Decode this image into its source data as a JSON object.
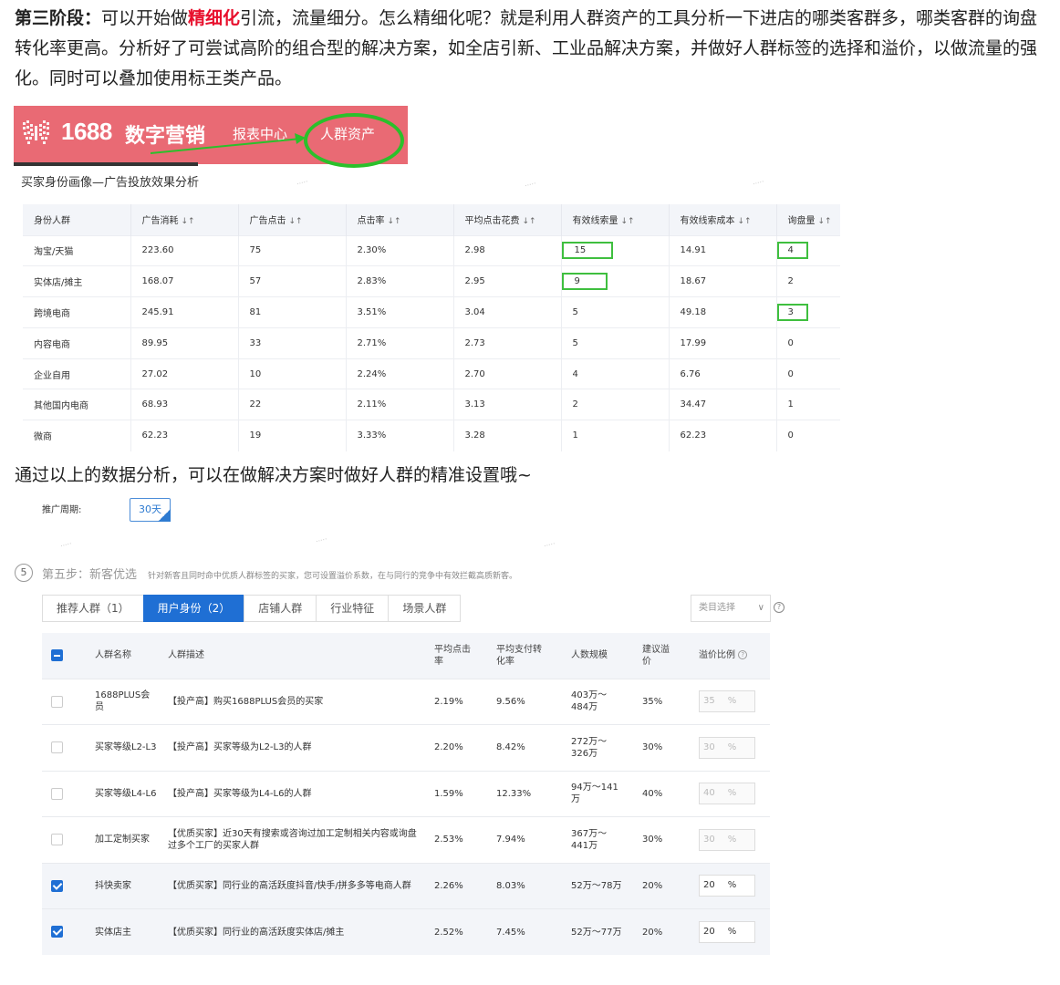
{
  "intro": {
    "lead_bold": "第三阶段：",
    "text_before": "可以开始做",
    "highlight": "精细化",
    "text_after": "引流，流量细分。怎么精细化呢？就是利用人群资产的工具分析一下进店的哪类客群多，哪类客群的询盘转化率更高。分析好了可尝试高阶的组合型的解决方案，如全店引新、工业品解决方案，并做好人群标签的选择和溢价，以做流量的强化。同时可以叠加使用标王类产品。"
  },
  "banner": {
    "brand_number": "1688",
    "brand_cn": "数字营销",
    "nav_report": "报表中心",
    "nav_crowd": "人群资产",
    "colors": {
      "bg": "#e96a74",
      "ring": "#2bc02b"
    }
  },
  "table1": {
    "title": "买家身份画像—广告投放效果分析",
    "headers": [
      "身份人群",
      "广告消耗",
      "广告点击",
      "点击率",
      "平均点击花费",
      "有效线索量",
      "有效线索成本",
      "询盘量"
    ],
    "rows": [
      [
        "淘宝/天猫",
        "223.60",
        "75",
        "2.30%",
        "2.98",
        "15",
        "14.91",
        "4"
      ],
      [
        "实体店/摊主",
        "168.07",
        "57",
        "2.83%",
        "2.95",
        "9",
        "18.67",
        "2"
      ],
      [
        "跨境电商",
        "245.91",
        "81",
        "3.51%",
        "3.04",
        "5",
        "49.18",
        "3"
      ],
      [
        "内容电商",
        "89.95",
        "33",
        "2.71%",
        "2.73",
        "5",
        "17.99",
        "0"
      ],
      [
        "企业自用",
        "27.02",
        "10",
        "2.24%",
        "2.70",
        "4",
        "6.76",
        "0"
      ],
      [
        "其他国内电商",
        "68.93",
        "22",
        "2.11%",
        "3.13",
        "2",
        "34.47",
        "1"
      ],
      [
        "微商",
        "62.23",
        "19",
        "3.33%",
        "3.28",
        "1",
        "62.23",
        "0"
      ]
    ]
  },
  "mid_text": "通过以上的数据分析，可以在做解决方案时做好人群的精准设置哦~",
  "panel": {
    "period_label": "推广周期:",
    "period_value": "30天",
    "step_number": "5",
    "step_title": "第五步：新客优选",
    "step_desc": "针对新客且同时命中优质人群标签的买家，您可设置溢价系数，在与同行的竞争中有效拦截高质新客。",
    "tabs": [
      "推荐人群（1）",
      "用户身份（2）",
      "店铺人群",
      "行业特征",
      "场景人群"
    ],
    "active_tab": 1,
    "category_placeholder": "类目选择",
    "headers": [
      "人群名称",
      "人群描述",
      "平均点击率",
      "平均支付转化率",
      "人数规模",
      "建议溢价",
      "溢价比例"
    ],
    "rows": [
      {
        "checked": false,
        "name": "1688PLUS会员",
        "desc": "【投产高】购买1688PLUS会员的买家",
        "ctr": "2.19%",
        "cvr": "9.56%",
        "scale": "403万～484万",
        "suggest": "35%",
        "ratio": "35",
        "unit": "%"
      },
      {
        "checked": false,
        "name": "买家等级L2-L3",
        "desc": "【投产高】买家等级为L2-L3的人群",
        "ctr": "2.20%",
        "cvr": "8.42%",
        "scale": "272万～326万",
        "suggest": "30%",
        "ratio": "30",
        "unit": "%"
      },
      {
        "checked": false,
        "name": "买家等级L4-L6",
        "desc": "【投产高】买家等级为L4-L6的人群",
        "ctr": "1.59%",
        "cvr": "12.33%",
        "scale": "94万～141万",
        "suggest": "40%",
        "ratio": "40",
        "unit": "%"
      },
      {
        "checked": false,
        "name": "加工定制买家",
        "desc": "【优质买家】近30天有搜索或咨询过加工定制相关内容或询盘过多个工厂的买家人群",
        "ctr": "2.53%",
        "cvr": "7.94%",
        "scale": "367万～441万",
        "suggest": "30%",
        "ratio": "30",
        "unit": "%"
      },
      {
        "checked": true,
        "name": "抖快卖家",
        "desc": "【优质买家】同行业的高活跃度抖音/快手/拼多多等电商人群",
        "ctr": "2.26%",
        "cvr": "8.03%",
        "scale": "52万～78万",
        "suggest": "20%",
        "ratio": "20",
        "unit": "%"
      },
      {
        "checked": true,
        "name": "实体店主",
        "desc": "【优质买家】同行业的高活跃度实体店/摊主",
        "ctr": "2.52%",
        "cvr": "7.45%",
        "scale": "52万～77万",
        "suggest": "20%",
        "ratio": "20",
        "unit": "%"
      }
    ]
  }
}
